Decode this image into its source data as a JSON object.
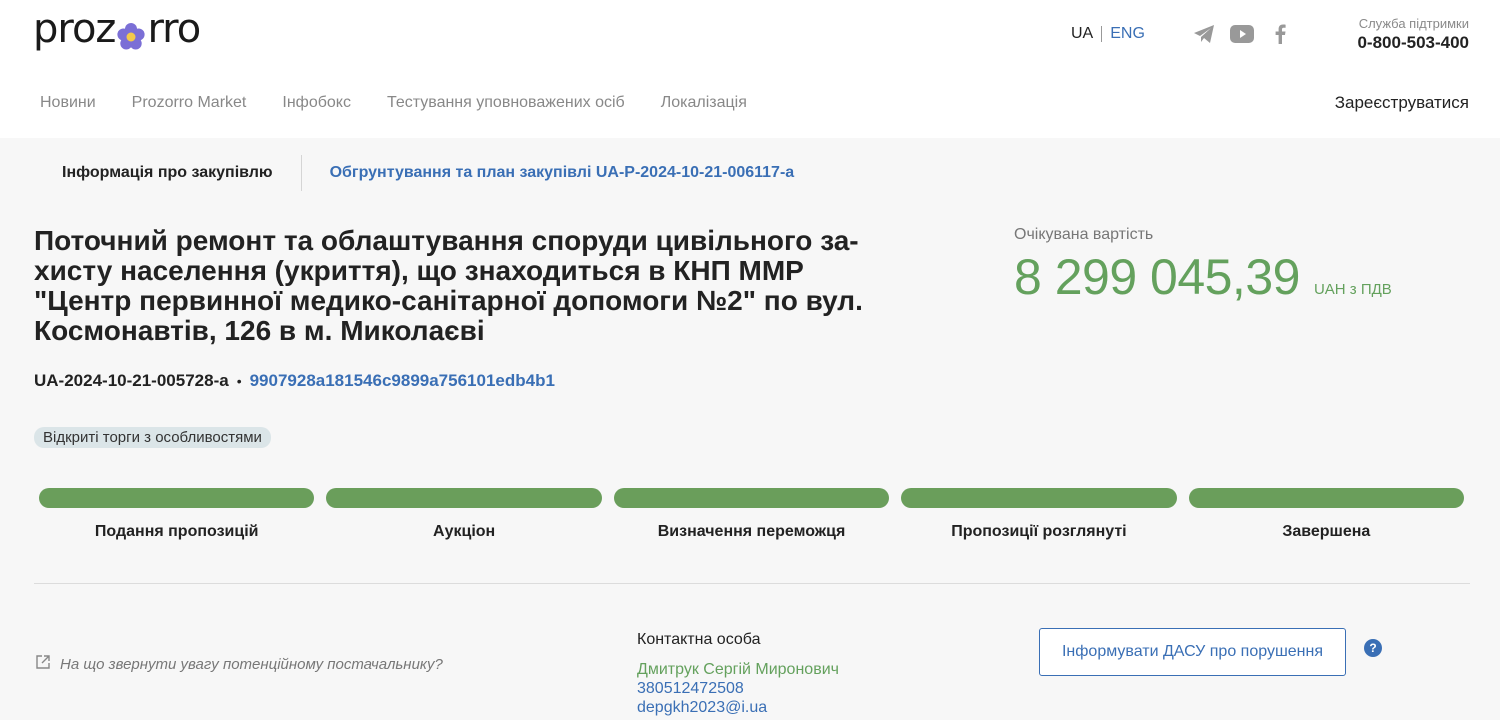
{
  "header": {
    "logo_left": "proz",
    "logo_right": "rro",
    "lang_ua": "UA",
    "lang_eng": "ENG",
    "support_label": "Служба підтримки",
    "support_phone": "0-800-503-400",
    "social_icons": [
      "telegram-icon",
      "youtube-icon",
      "facebook-icon"
    ]
  },
  "nav": {
    "items": [
      "Новини",
      "Prozorro Market",
      "Інфобокс",
      "Тестування уповноважених осіб",
      "Локалізація"
    ],
    "register": "Зареєструватися"
  },
  "subtabs": {
    "active": "Інформація про закупівлю",
    "link": "Обгрунтування та план закупівлі UA-P-2024-10-21-006117-a"
  },
  "tender": {
    "title": "Поточний ремонт та облаштування споруди цивільного захисту населення (укриття), що знаходиться в КНП ММР \"Центр первинної медико-санітарної допомоги №2\" по вул. Космонавтів, 126 в м. Миколаєві",
    "title_lines": [
      "Поточний ремонт та облаштування споруди цивільного за-",
      "хисту населення (укриття), що знаходиться в КНП ММР",
      "\"Центр первинної медико-санітарної допомоги №2\" по вул.",
      "Космонавтів, 126 в м. Миколаєві"
    ],
    "id": "UA-2024-10-21-005728-a",
    "separator": "•",
    "hash": "9907928a181546c9899a756101edb4b1",
    "procedure_badge": "Відкриті торги з особливостями",
    "value_label": "Очікувана вартість",
    "value_amount": "8 299 045,39",
    "value_currency": "UAH з ПДВ"
  },
  "stages": [
    {
      "label": "Подання пропозицій",
      "completed": true
    },
    {
      "label": "Аукціон",
      "completed": true
    },
    {
      "label": "Визначення переможця",
      "completed": true
    },
    {
      "label": "Пропозиції розглянуті",
      "completed": true
    },
    {
      "label": "Завершена",
      "completed": true
    }
  ],
  "footer": {
    "hint": "На що звернути увагу потенційному постачальнику?",
    "contact_label": "Контактна особа",
    "contact_name": "Дмитрук Сергій Миронович",
    "contact_phone": "380512472508",
    "contact_email": "depgkh2023@i.ua",
    "report_button": "Інформувати ДАСУ про порушення",
    "help_symbol": "?"
  },
  "colors": {
    "accent_blue": "#3a6fb5",
    "accent_green": "#64a15d",
    "stage_green": "#6a9e5b",
    "logo_flower": "#7b6fd6"
  }
}
